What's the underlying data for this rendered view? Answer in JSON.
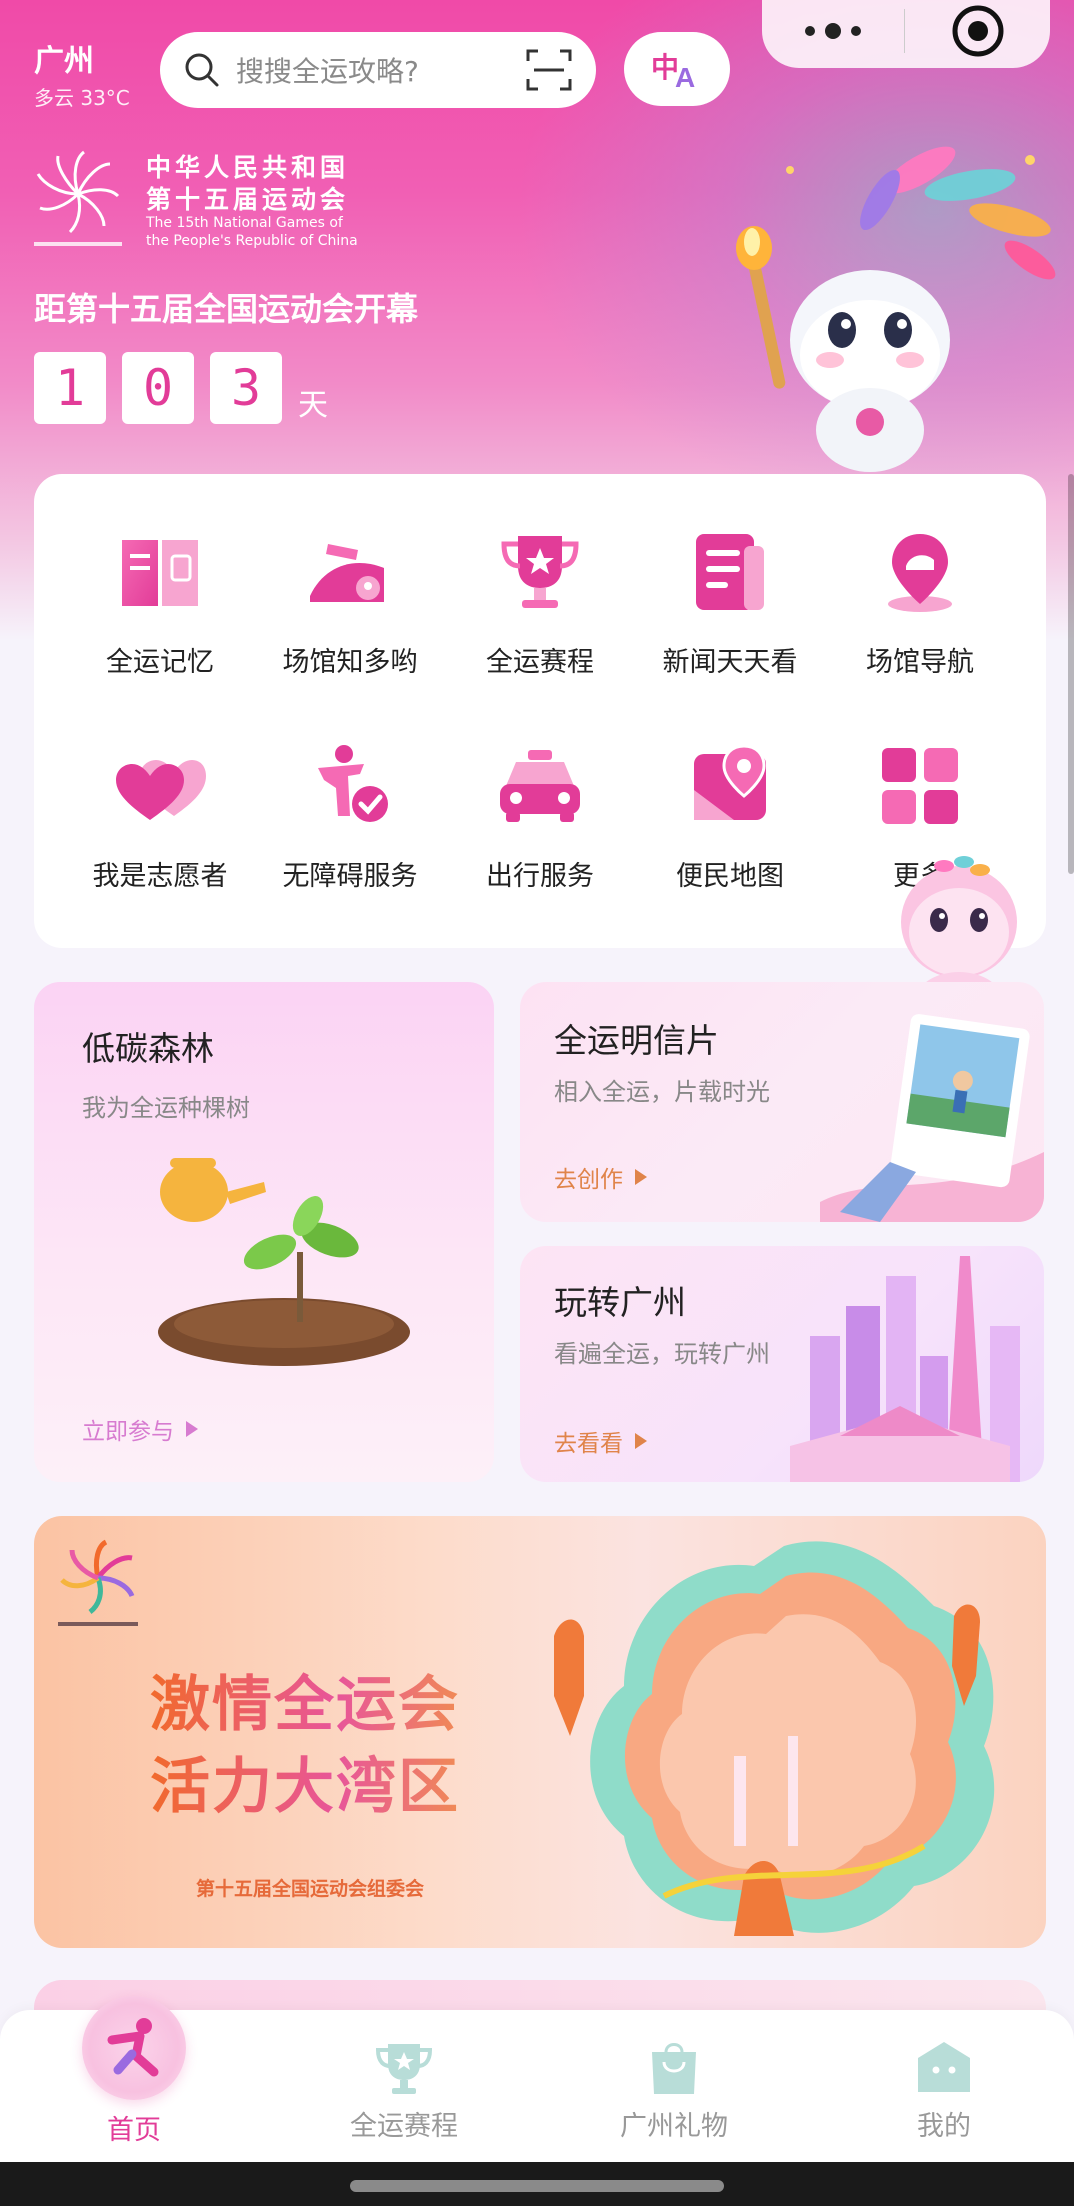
{
  "header": {
    "city": "广州",
    "weather": "多云 33°C",
    "search_placeholder": "搜搜全运攻略?"
  },
  "games": {
    "title_cn_line1": "中华人民共和国",
    "title_cn_line2": "第十五届运动会",
    "title_en_line1": "The 15th National Games of",
    "title_en_line2": "the People's Republic of China",
    "countdown_label": "距第十五届全国运动会开幕",
    "digits": [
      "1",
      "0",
      "3"
    ],
    "unit": "天"
  },
  "services": [
    {
      "label": "全运记忆",
      "icon": "book-icon"
    },
    {
      "label": "场馆知多哟",
      "icon": "venue-info-icon"
    },
    {
      "label": "全运赛程",
      "icon": "trophy-icon"
    },
    {
      "label": "新闻天天看",
      "icon": "news-icon"
    },
    {
      "label": "场馆导航",
      "icon": "location-pin-icon"
    },
    {
      "label": "我是志愿者",
      "icon": "hearts-icon"
    },
    {
      "label": "无障碍服务",
      "icon": "accessibility-icon"
    },
    {
      "label": "出行服务",
      "icon": "taxi-icon"
    },
    {
      "label": "便民地图",
      "icon": "map-icon"
    },
    {
      "label": "更多",
      "icon": "grid-icon"
    }
  ],
  "cards": {
    "forest": {
      "title": "低碳森林",
      "subtitle": "我为全运种棵树",
      "action": "立即参与"
    },
    "postcard": {
      "title": "全运明信片",
      "subtitle": "相入全运，片载时光",
      "action": "去创作"
    },
    "guangzhou": {
      "title": "玩转广州",
      "subtitle": "看遍全运，玩转广州",
      "action": "去看看"
    }
  },
  "banner": {
    "line1": "激情全运会",
    "line2": "活力大湾区",
    "sub": "第十五届全国运动会组委会"
  },
  "tabs": [
    {
      "label": "首页",
      "icon": "home-runner-icon",
      "active": true
    },
    {
      "label": "全运赛程",
      "icon": "trophy-icon",
      "active": false
    },
    {
      "label": "广州礼物",
      "icon": "gift-bag-icon",
      "active": false
    },
    {
      "label": "我的",
      "icon": "profile-icon",
      "active": false
    }
  ],
  "colors": {
    "brand_pink": "#e23c98",
    "action_orange": "#e0844a",
    "action_pink": "#d77bd0"
  }
}
